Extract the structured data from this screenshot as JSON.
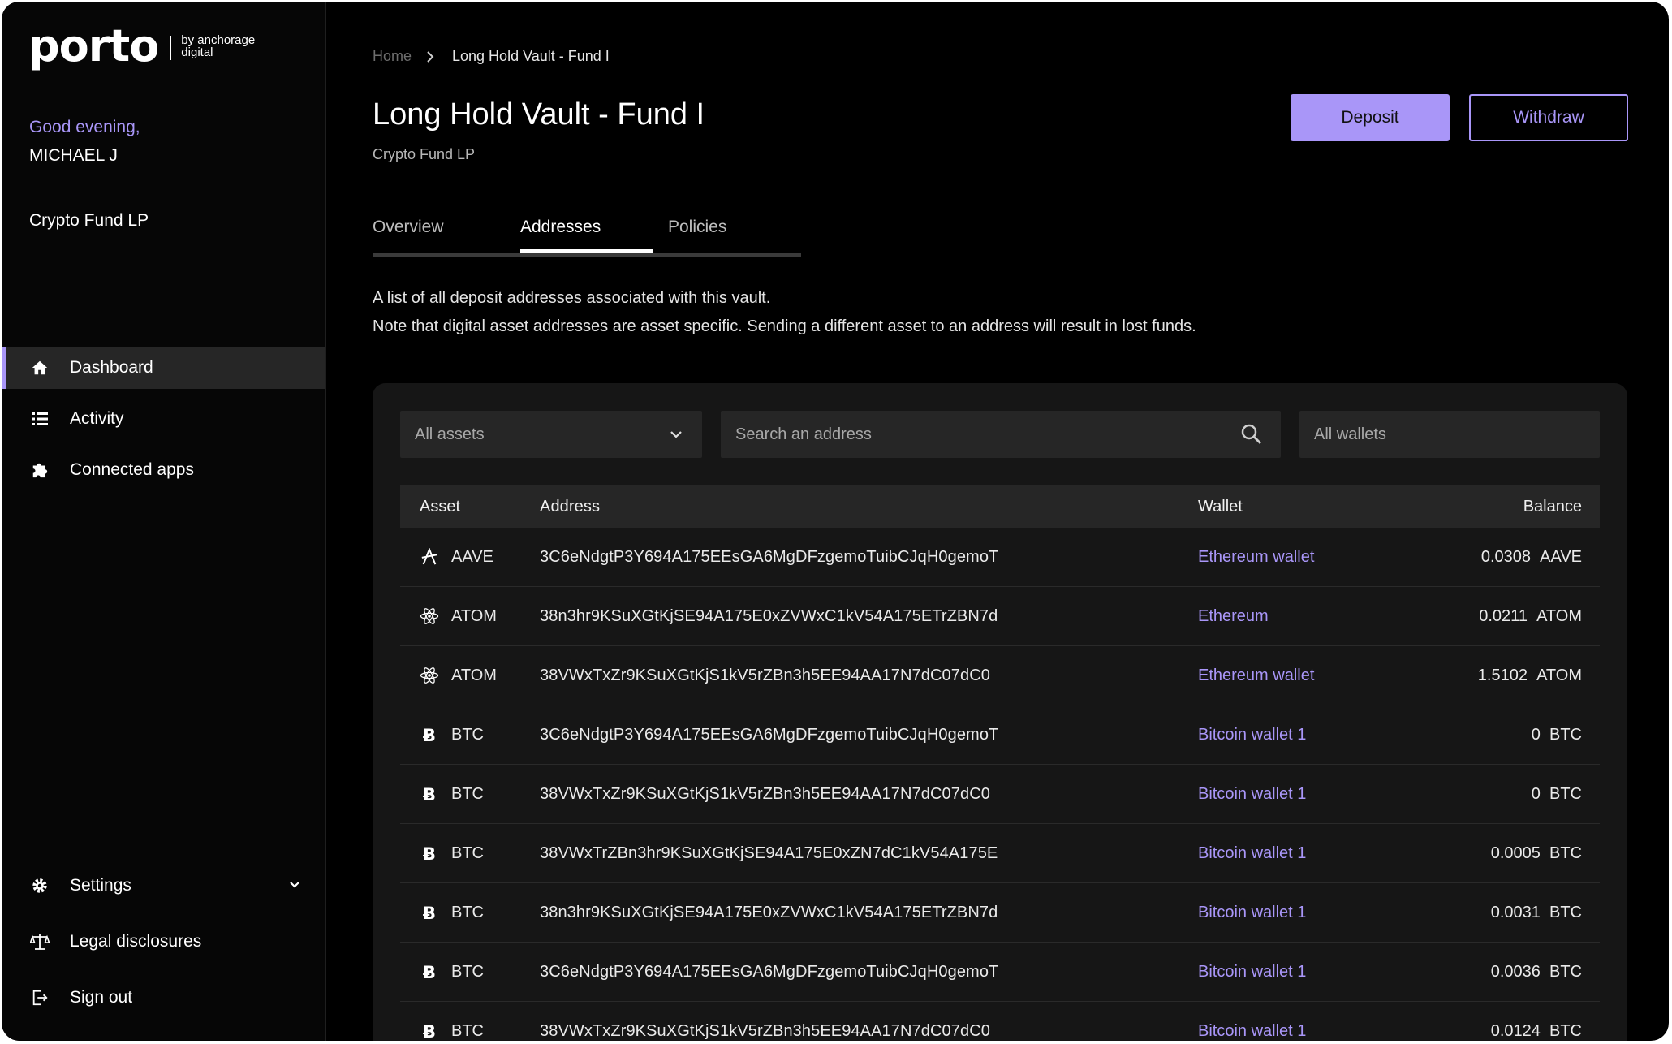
{
  "brand": {
    "name": "porto",
    "tagline_line1": "by anchorage",
    "tagline_line2": "digital"
  },
  "user": {
    "greeting": "Good evening,",
    "name": "MICHAEL J",
    "org": "Crypto Fund LP"
  },
  "sidebar": {
    "items": [
      {
        "label": "Dashboard",
        "icon": "home-icon",
        "active": true
      },
      {
        "label": "Activity",
        "icon": "list-icon",
        "active": false
      },
      {
        "label": "Connected apps",
        "icon": "puzzle-icon",
        "active": false
      }
    ],
    "bottom": [
      {
        "label": "Settings",
        "icon": "gear-icon"
      },
      {
        "label": "Legal disclosures",
        "icon": "scale-icon"
      },
      {
        "label": "Sign out",
        "icon": "sign-out-icon"
      }
    ]
  },
  "breadcrumb": {
    "home": "Home",
    "current": "Long Hold Vault - Fund I"
  },
  "header": {
    "title": "Long Hold Vault - Fund I",
    "subtitle": "Crypto Fund LP",
    "deposit_label": "Deposit",
    "withdraw_label": "Withdraw"
  },
  "tabs": [
    {
      "label": "Overview"
    },
    {
      "label": "Addresses",
      "active": true
    },
    {
      "label": "Policies"
    }
  ],
  "description": {
    "line1": "A list of all deposit addresses associated with this vault.",
    "line2": "Note that digital asset addresses are asset specific. Sending a different asset to an address will result in lost funds."
  },
  "filters": {
    "asset_value": "All assets",
    "search_placeholder": "Search an address",
    "wallet_value": "All wallets"
  },
  "table": {
    "headers": {
      "asset": "Asset",
      "address": "Address",
      "wallet": "Wallet",
      "balance": "Balance"
    },
    "rows": [
      {
        "asset": "AAVE",
        "icon": "aave-icon",
        "address": "3C6eNdgtP3Y694A175EEsGA6MgDFzgemoTuibCJqH0gemoT",
        "wallet": "Ethereum wallet",
        "amount": "0.0308",
        "unit": "AAVE"
      },
      {
        "asset": "ATOM",
        "icon": "atom-icon",
        "address": "38n3hr9KSuXGtKjSE94A175E0xZVWxC1kV54A175ETrZBN7d",
        "wallet": "Ethereum",
        "amount": "0.0211",
        "unit": "ATOM"
      },
      {
        "asset": "ATOM",
        "icon": "atom-icon",
        "address": "38VWxTxZr9KSuXGtKjS1kV5rZBn3h5EE94AA17N7dC07dC0",
        "wallet": "Ethereum wallet",
        "amount": "1.5102",
        "unit": "ATOM"
      },
      {
        "asset": "BTC",
        "icon": "bitcoin-icon",
        "address": "3C6eNdgtP3Y694A175EEsGA6MgDFzgemoTuibCJqH0gemoT",
        "wallet": "Bitcoin wallet 1",
        "amount": "0",
        "unit": "BTC"
      },
      {
        "asset": "BTC",
        "icon": "bitcoin-icon",
        "address": "38VWxTxZr9KSuXGtKjS1kV5rZBn3h5EE94AA17N7dC07dC0",
        "wallet": "Bitcoin wallet 1",
        "amount": "0",
        "unit": "BTC"
      },
      {
        "asset": "BTC",
        "icon": "bitcoin-icon",
        "address": "38VWxTrZBn3hr9KSuXGtKjSE94A175E0xZN7dC1kV54A175E",
        "wallet": "Bitcoin wallet 1",
        "amount": "0.0005",
        "unit": "BTC"
      },
      {
        "asset": "BTC",
        "icon": "bitcoin-icon",
        "address": "38n3hr9KSuXGtKjSE94A175E0xZVWxC1kV54A175ETrZBN7d",
        "wallet": "Bitcoin wallet 1",
        "amount": "0.0031",
        "unit": "BTC"
      },
      {
        "asset": "BTC",
        "icon": "bitcoin-icon",
        "address": "3C6eNdgtP3Y694A175EEsGA6MgDFzgemoTuibCJqH0gemoT",
        "wallet": "Bitcoin wallet 1",
        "amount": "0.0036",
        "unit": "BTC"
      },
      {
        "asset": "BTC",
        "icon": "bitcoin-icon",
        "address": "38VWxTxZr9KSuXGtKjS1kV5rZBn3h5EE94AA17N7dC07dC0",
        "wallet": "Bitcoin wallet 1",
        "amount": "0.0124",
        "unit": "BTC"
      }
    ]
  },
  "colors": {
    "accent": "#a996f8",
    "background": "#000000",
    "panel": "#161616",
    "control": "#262626"
  }
}
